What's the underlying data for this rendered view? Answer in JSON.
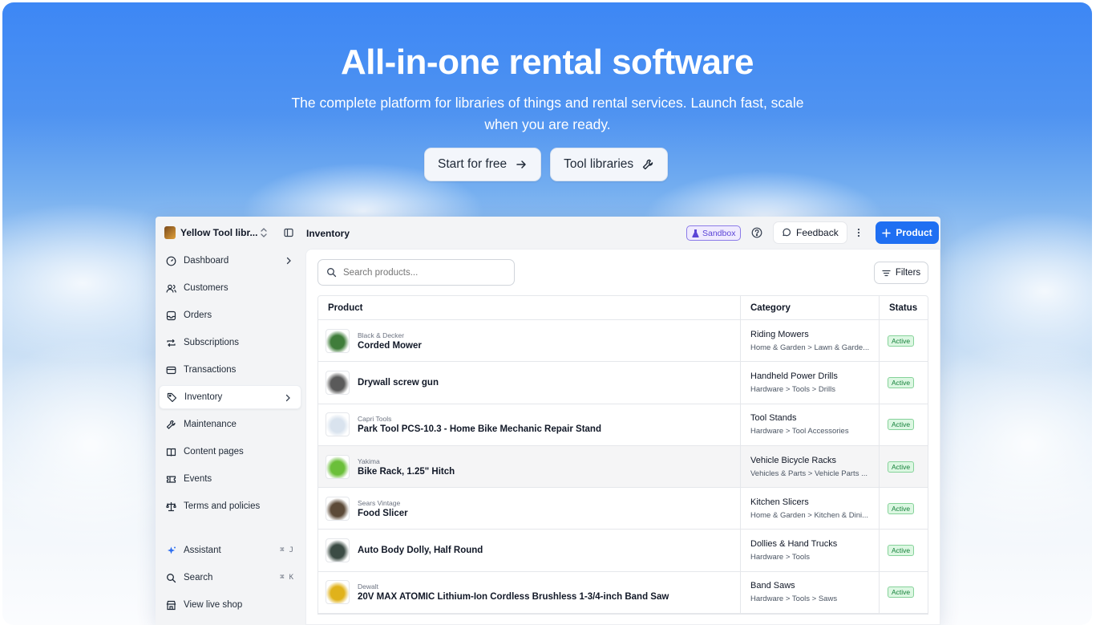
{
  "hero": {
    "title": "All-in-one rental software",
    "subtitle": "The complete platform for libraries of things and rental services. Launch fast, scale when you are ready.",
    "cta_primary": "Start for free",
    "cta_secondary": "Tool libraries"
  },
  "app": {
    "workspace_name": "Yellow Tool libr...",
    "page_title": "Inventory",
    "sandbox_label": "Sandbox",
    "feedback_label": "Feedback",
    "add_product_label": "Product",
    "sidebar": {
      "items": [
        {
          "label": "Dashboard",
          "icon": "gauge-icon",
          "chevron": true
        },
        {
          "label": "Customers",
          "icon": "users-icon"
        },
        {
          "label": "Orders",
          "icon": "inbox-icon"
        },
        {
          "label": "Subscriptions",
          "icon": "repeat-icon"
        },
        {
          "label": "Transactions",
          "icon": "card-icon"
        },
        {
          "label": "Inventory",
          "icon": "tag-icon",
          "chevron": true,
          "active": true
        },
        {
          "label": "Maintenance",
          "icon": "wrench-icon"
        },
        {
          "label": "Content pages",
          "icon": "book-icon"
        },
        {
          "label": "Events",
          "icon": "ticket-icon"
        },
        {
          "label": "Terms and policies",
          "icon": "scale-icon"
        }
      ],
      "bottom": [
        {
          "label": "Assistant",
          "icon": "sparkle-icon",
          "kbd": [
            "⌘",
            "J"
          ]
        },
        {
          "label": "Search",
          "icon": "search-icon",
          "kbd": [
            "⌘",
            "K"
          ]
        },
        {
          "label": "View live shop",
          "icon": "store-icon"
        }
      ]
    },
    "search_placeholder": "Search products...",
    "filters_label": "Filters",
    "table": {
      "headers": [
        "Product",
        "Category",
        "Status"
      ],
      "rows": [
        {
          "brand": "Black & Decker",
          "name": "Corded Mower",
          "category": "Riding Mowers",
          "path": "Home & Garden > Lawn & Garde...",
          "status": "Active",
          "thumb": "#3f7d3a"
        },
        {
          "brand": "",
          "name": "Drywall screw gun",
          "category": "Handheld Power Drills",
          "path": "Hardware > Tools > Drills",
          "status": "Active",
          "thumb": "#5a5a5a"
        },
        {
          "brand": "Capri Tools",
          "name": "Park Tool PCS-10.3 - Home Bike Mechanic Repair Stand",
          "category": "Tool Stands",
          "path": "Hardware > Tool Accessories",
          "status": "Active",
          "thumb": "#d9e3ee"
        },
        {
          "brand": "Yakima",
          "name": "Bike Rack, 1.25\" Hitch",
          "category": "Vehicle Bicycle Racks",
          "path": "Vehicles & Parts > Vehicle Parts ...",
          "status": "Active",
          "thumb": "#6bbf3a"
        },
        {
          "brand": "Sears Vintage",
          "name": "Food Slicer",
          "category": "Kitchen Slicers",
          "path": "Home & Garden > Kitchen & Dini...",
          "status": "Active",
          "thumb": "#5c4a38"
        },
        {
          "brand": "",
          "name": "Auto Body Dolly, Half Round",
          "category": "Dollies & Hand Trucks",
          "path": "Hardware > Tools",
          "status": "Active",
          "thumb": "#3b4b44"
        },
        {
          "brand": "Dewalt",
          "name": "20V MAX ATOMIC Lithium-Ion Cordless Brushless 1-3/4-inch Band Saw",
          "category": "Band Saws",
          "path": "Hardware > Tools > Saws",
          "status": "Active",
          "thumb": "#e0b21b"
        }
      ]
    }
  },
  "colors": {
    "accent": "#1f6ff2",
    "active_badge_bg": "#dcf7e2",
    "active_badge_text": "#16803b",
    "sandbox": "#5b45d6"
  }
}
